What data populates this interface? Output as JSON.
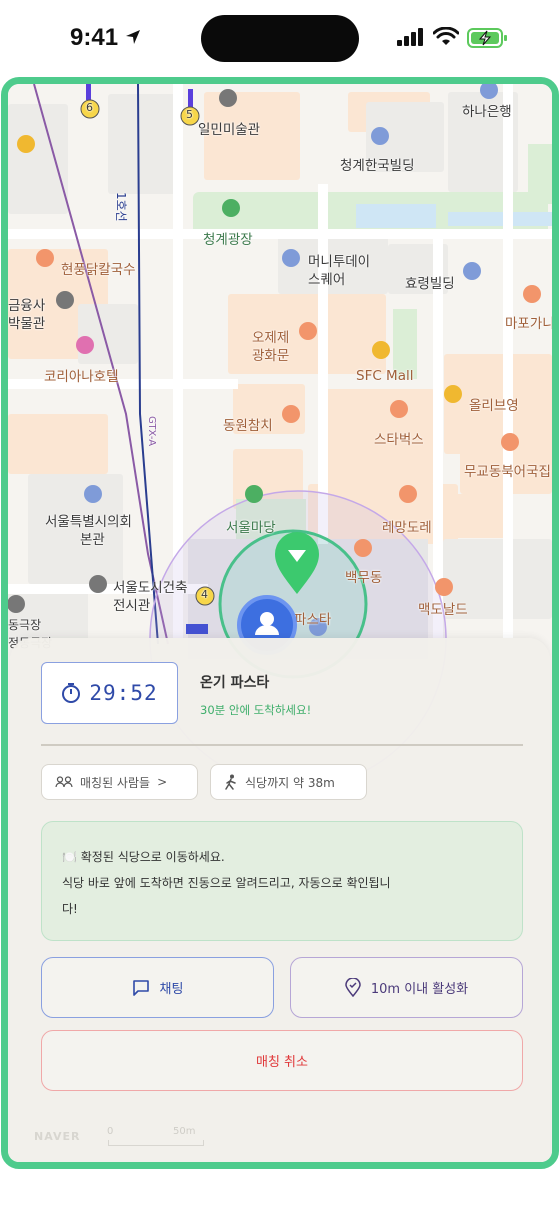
{
  "status_bar": {
    "time": "9:41"
  },
  "map": {
    "labels": {
      "seoul_museum_of_art": "일민미술관",
      "hana_bank": "하나은행",
      "cheonggye_hanguk_building": "청계한국빌딩",
      "cheonggye_plaza": "청계광장",
      "money_today_square_1": "머니투데이",
      "money_today_square_2": "스퀘어",
      "hyoryeong_building": "효령빌딩",
      "hyunpung_kalguksu": "현풍닭칼국수",
      "financial_museum_1": "금융사",
      "financial_museum_2": "박물관",
      "mapo_galbi": "마포가니",
      "koreana_hotel": "코리아나호텔",
      "ojeje_1": "오제제",
      "ojeje_2": "광화문",
      "sfc_mall": "SFC Mall",
      "olive_young": "올리브영",
      "dongwon_chamchi": "동원참치",
      "starbucks": "스타벅스",
      "mugyodong_bugeoguk": "무교동북어국집",
      "seoul_council_1": "서울특별시의회",
      "seoul_council_2": "본관",
      "seoul_madang": "서울마당",
      "remang_dore": "레망도레",
      "baekmudong": "백무동",
      "seoul_architecture_1": "서울도시건축",
      "seoul_architecture_2": "전시관",
      "mcdonalds": "맥도날드",
      "pasta_partial": "파스타",
      "theater_1": "동극장",
      "theater_2": "정동극장",
      "line1": "1호선",
      "gtx": "GTX-A",
      "exit_6": "6",
      "exit_5": "5",
      "exit_4": "4"
    }
  },
  "sheet": {
    "timer": "29:52",
    "restaurant_name": "온기 파스타",
    "restaurant_sub": "30분 안에 도착하세요!",
    "matched_people": "매칭된 사람들",
    "matched_chevron": ">",
    "walk_distance": "식당까지 약 38m",
    "notice_line1": "🍽️ 확정된 식당으로 이동하세요.",
    "notice_line2": "식당 바로 앞에 도착하면 진동으로 알려드리고, 자동으로 확인됩니",
    "notice_line3": "다!",
    "chat_label": "채팅",
    "activate_label": "10m 이내 활성화",
    "cancel_label": "매칭 취소",
    "naver_logo": "NAVER",
    "scale_zero": "0",
    "scale_fifty": "50m"
  },
  "colors": {
    "frame": "#4ecb8c",
    "primary_blue": "#2f4aa8",
    "accent_green": "#3fae6b",
    "cancel_red": "#e0383a"
  }
}
